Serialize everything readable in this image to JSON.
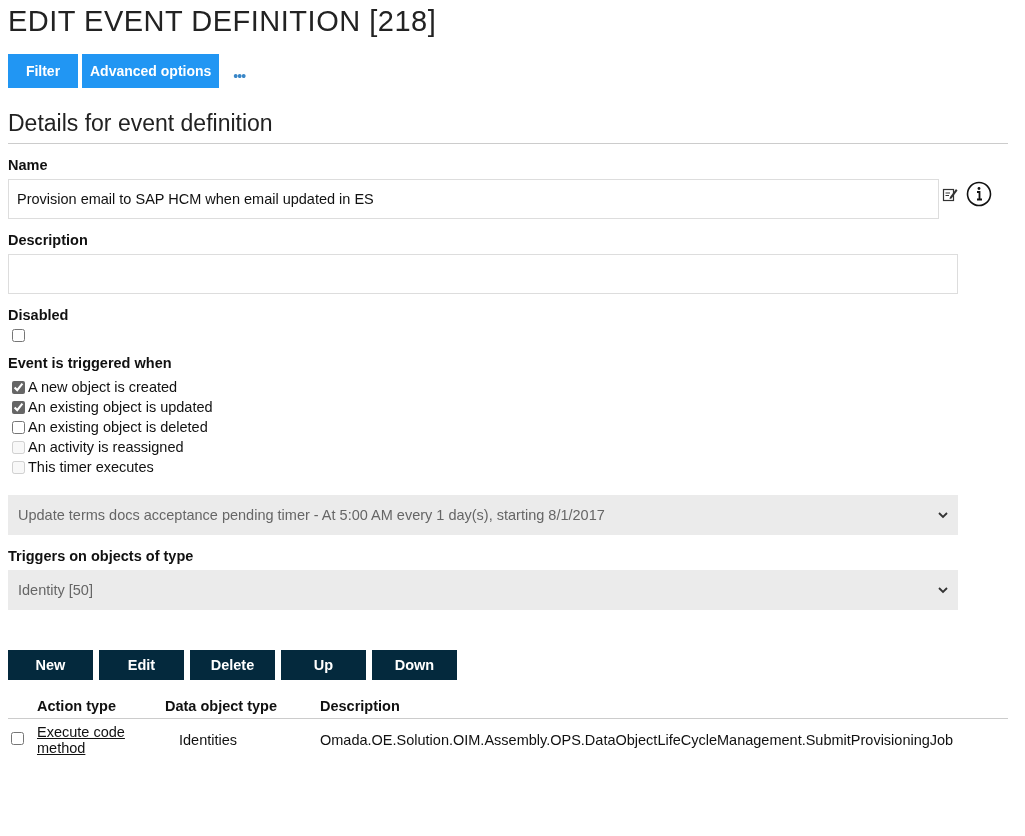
{
  "page_title": "EDIT EVENT DEFINITION [218]",
  "toolbar": {
    "buttons": [
      "Filter",
      "Advanced options"
    ],
    "more": "•••"
  },
  "section_title": "Details for event definition",
  "name_field": {
    "label": "Name",
    "value": "Provision email to SAP HCM when email updated in ES"
  },
  "description_field": {
    "label": "Description"
  },
  "disabled_field": {
    "label": "Disabled",
    "checked": false
  },
  "triggers": {
    "label": "Event is triggered when",
    "options": [
      {
        "label": "A new object is created",
        "checked": true,
        "disabled": false
      },
      {
        "label": "An existing object is updated",
        "checked": true,
        "disabled": false
      },
      {
        "label": "An existing object is deleted",
        "checked": false,
        "disabled": false
      },
      {
        "label": "An activity is reassigned",
        "checked": false,
        "disabled": true
      },
      {
        "label": "This timer executes",
        "checked": false,
        "disabled": true
      }
    ]
  },
  "timer_select": {
    "value": "Update terms docs acceptance pending timer - At 5:00 AM every 1 day(s), starting 8/1/2017",
    "disabled": true
  },
  "object_type_select": {
    "label": "Triggers on objects of type",
    "value": "Identity [50]",
    "disabled": true
  },
  "action_buttons": [
    "New",
    "Edit",
    "Delete",
    "Up",
    "Down"
  ],
  "table": {
    "columns": [
      "Action type",
      "Data object type",
      "Description"
    ],
    "rows": [
      {
        "checked": false,
        "action_type": "Execute code method",
        "data_object_type": "Identities",
        "description": "Omada.OE.Solution.OIM.Assembly.OPS.DataObjectLifeCycleManagement.SubmitProvisioningJob"
      }
    ]
  }
}
